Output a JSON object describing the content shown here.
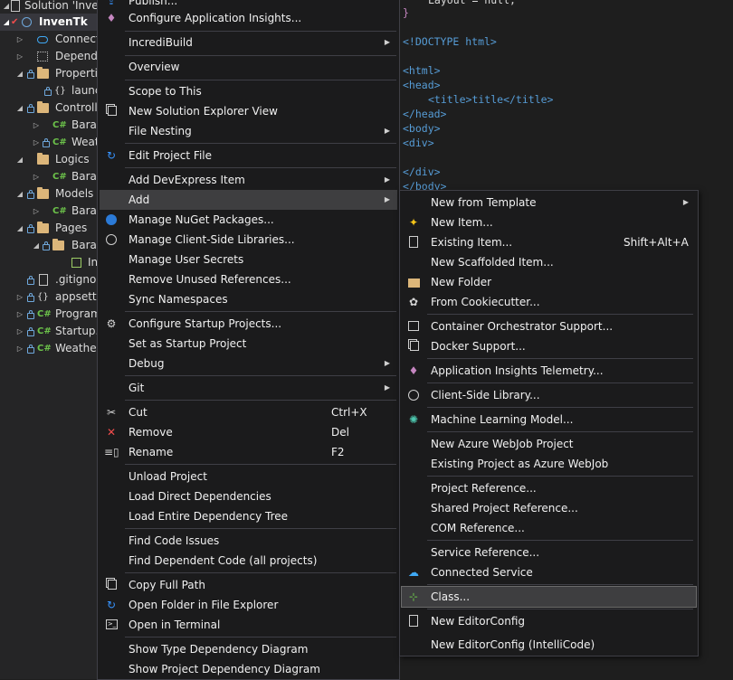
{
  "explorer": {
    "rows": [
      {
        "label": "Solution 'InvenTk'"
      },
      {
        "label": "InvenTk"
      },
      {
        "label": "Connected Services"
      },
      {
        "label": "Dependencies"
      },
      {
        "label": "Properties"
      },
      {
        "label": "launchSettings.json"
      },
      {
        "label": "Controllers"
      },
      {
        "label": "BaramController.cs"
      },
      {
        "label": "WeatherForecastController.cs"
      },
      {
        "label": "Logics"
      },
      {
        "label": "BaramLogic.cs"
      },
      {
        "label": "Models"
      },
      {
        "label": "BaramModel.cs"
      },
      {
        "label": "Pages"
      },
      {
        "label": "Baram"
      },
      {
        "label": "Index.cshtml"
      },
      {
        "label": ".gitignore"
      },
      {
        "label": "appsettings.json"
      },
      {
        "label": "Program.cs"
      },
      {
        "label": "Startup.cs"
      },
      {
        "label": "WeatherForecast.cs"
      }
    ]
  },
  "editor": {
    "lines": [
      "Layout = null;",
      "}",
      "<!DOCTYPE html>",
      "<html>",
      "<head>",
      "<title>title</title>",
      "</head>",
      "<body>",
      "<div>",
      "</div>",
      "</body>"
    ]
  },
  "context_menu": {
    "items": [
      {
        "label": "Publish..."
      },
      {
        "label": "Configure Application Insights..."
      },
      {
        "label": "IncrediBuild"
      },
      {
        "label": "Overview"
      },
      {
        "label": "Scope to This"
      },
      {
        "label": "New Solution Explorer View"
      },
      {
        "label": "File Nesting"
      },
      {
        "label": "Edit Project File"
      },
      {
        "label": "Add DevExpress Item"
      },
      {
        "label": "Add"
      },
      {
        "label": "Manage NuGet Packages..."
      },
      {
        "label": "Manage Client-Side Libraries..."
      },
      {
        "label": "Manage User Secrets"
      },
      {
        "label": "Remove Unused References..."
      },
      {
        "label": "Sync Namespaces"
      },
      {
        "label": "Configure Startup Projects..."
      },
      {
        "label": "Set as Startup Project"
      },
      {
        "label": "Debug"
      },
      {
        "label": "Git"
      },
      {
        "label": "Cut",
        "shortcut": "Ctrl+X"
      },
      {
        "label": "Remove",
        "shortcut": "Del"
      },
      {
        "label": "Rename",
        "shortcut": "F2"
      },
      {
        "label": "Unload Project"
      },
      {
        "label": "Load Direct Dependencies"
      },
      {
        "label": "Load Entire Dependency Tree"
      },
      {
        "label": "Find Code Issues"
      },
      {
        "label": "Find Dependent Code (all projects)"
      },
      {
        "label": "Copy Full Path"
      },
      {
        "label": "Open Folder in File Explorer"
      },
      {
        "label": "Open in Terminal"
      },
      {
        "label": "Show Type Dependency Diagram"
      },
      {
        "label": "Show Project Dependency Diagram"
      }
    ]
  },
  "add_submenu": {
    "items": [
      {
        "label": "New from Template"
      },
      {
        "label": "New Item..."
      },
      {
        "label": "Existing Item...",
        "shortcut": "Shift+Alt+A"
      },
      {
        "label": "New Scaffolded Item..."
      },
      {
        "label": "New Folder"
      },
      {
        "label": "From Cookiecutter..."
      },
      {
        "label": "Container Orchestrator Support..."
      },
      {
        "label": "Docker Support..."
      },
      {
        "label": "Application Insights Telemetry..."
      },
      {
        "label": "Client-Side Library..."
      },
      {
        "label": "Machine Learning Model..."
      },
      {
        "label": "New Azure WebJob Project"
      },
      {
        "label": "Existing Project as Azure WebJob"
      },
      {
        "label": "Project Reference..."
      },
      {
        "label": "Shared Project Reference..."
      },
      {
        "label": "COM Reference..."
      },
      {
        "label": "Service Reference..."
      },
      {
        "label": "Connected Service"
      },
      {
        "label": "Class..."
      },
      {
        "label": "New EditorConfig"
      },
      {
        "label": "New EditorConfig (IntelliCode)"
      }
    ]
  },
  "colors": {
    "menu_bg": "#1b1b1c",
    "menu_border": "#3f3f46",
    "highlight": "#3e3e40",
    "explorer_bg": "#252526",
    "editor_bg": "#1e1e1e",
    "tag_blue": "#569cd6",
    "cs_green": "#6cc24a",
    "folder_yellow": "#dcb67a"
  }
}
